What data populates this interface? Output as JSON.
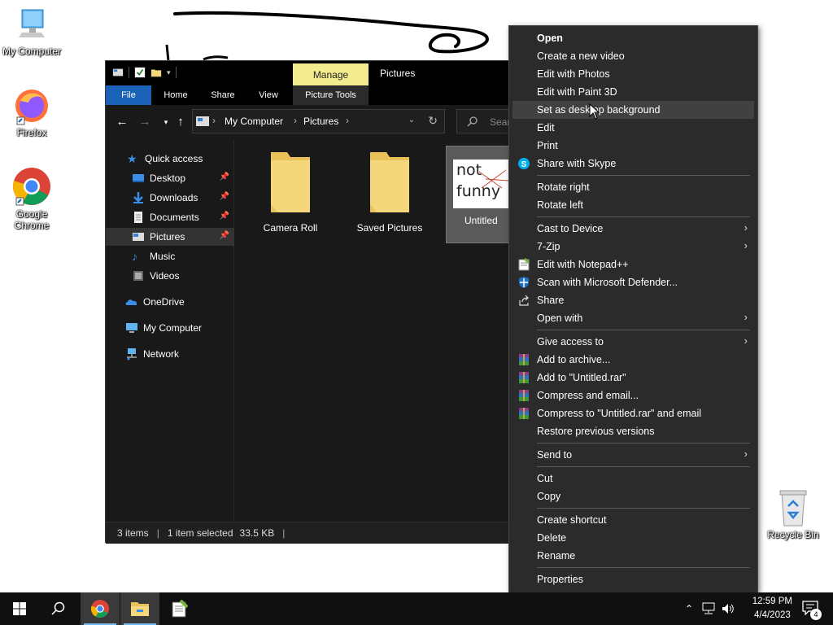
{
  "desktop": {
    "icons": [
      {
        "label": "My Computer"
      },
      {
        "label": "Firefox"
      },
      {
        "label": "Google Chrome"
      },
      {
        "label": "Recycle Bin"
      }
    ]
  },
  "explorer": {
    "quick_access_toolbar": [
      "properties-icon",
      "checkmark-icon",
      "new-folder-icon",
      "dropdown-icon"
    ],
    "contextual_tab_label": "Manage",
    "window_title": "Pictures",
    "ribbon_tabs": [
      "File",
      "Home",
      "Share",
      "View",
      "Picture Tools"
    ],
    "address": {
      "crumbs": [
        "My Computer",
        "Pictures"
      ]
    },
    "search_placeholder": "Sear",
    "nav_pane": [
      {
        "label": "Quick access",
        "icon": "star-icon",
        "pinned": false
      },
      {
        "label": "Desktop",
        "icon": "desktop-folder-icon",
        "pinned": true
      },
      {
        "label": "Downloads",
        "icon": "downloads-icon",
        "pinned": true
      },
      {
        "label": "Documents",
        "icon": "documents-icon",
        "pinned": true
      },
      {
        "label": "Pictures",
        "icon": "pictures-icon",
        "pinned": true,
        "selected": true
      },
      {
        "label": "Music",
        "icon": "music-icon",
        "pinned": false
      },
      {
        "label": "Videos",
        "icon": "videos-icon",
        "pinned": false
      },
      {
        "label": "OneDrive",
        "icon": "onedrive-icon",
        "pinned": false
      },
      {
        "label": "My Computer",
        "icon": "computer-icon",
        "pinned": false
      },
      {
        "label": "Network",
        "icon": "network-icon",
        "pinned": false
      }
    ],
    "items": [
      {
        "label": "Camera Roll",
        "type": "folder"
      },
      {
        "label": "Saved Pictures",
        "type": "folder"
      },
      {
        "label": "Untitled",
        "type": "image",
        "thumbnail_text_1": "not",
        "thumbnail_text_2": "funny",
        "selected": true
      }
    ],
    "status": {
      "count": "3 items",
      "selection": "1 item selected",
      "size": "33.5 KB"
    }
  },
  "context_menu": {
    "items": [
      {
        "label": "Open",
        "bold": true
      },
      {
        "label": "Create a new video"
      },
      {
        "label": "Edit with Photos"
      },
      {
        "label": "Edit with Paint 3D"
      },
      {
        "label": "Set as desktop background",
        "highlighted": true
      },
      {
        "label": "Edit"
      },
      {
        "label": "Print"
      },
      {
        "label": "Share with Skype",
        "icon": "skype-icon"
      },
      {
        "label": "Rotate right"
      },
      {
        "label": "Rotate left"
      },
      {
        "label": "Cast to Device",
        "submenu": true
      },
      {
        "label": "7-Zip",
        "submenu": true
      },
      {
        "label": "Edit with Notepad++",
        "icon": "notepadpp-icon"
      },
      {
        "label": "Scan with Microsoft Defender...",
        "icon": "defender-icon"
      },
      {
        "label": "Share",
        "icon": "share-icon"
      },
      {
        "label": "Open with",
        "submenu": true
      },
      {
        "label": "Give access to",
        "submenu": true
      },
      {
        "label": "Add to archive...",
        "icon": "winrar-icon"
      },
      {
        "label": "Add to \"Untitled.rar\"",
        "icon": "winrar-icon"
      },
      {
        "label": "Compress and email...",
        "icon": "winrar-icon"
      },
      {
        "label": "Compress to \"Untitled.rar\" and email",
        "icon": "winrar-icon"
      },
      {
        "label": "Restore previous versions"
      },
      {
        "label": "Send to",
        "submenu": true
      },
      {
        "label": "Cut"
      },
      {
        "label": "Copy"
      },
      {
        "label": "Create shortcut"
      },
      {
        "label": "Delete"
      },
      {
        "label": "Rename"
      },
      {
        "label": "Properties"
      }
    ]
  },
  "taskbar": {
    "apps": [
      "start-icon",
      "search-icon",
      "chrome-icon",
      "file-explorer-icon",
      "notepadpp-icon"
    ],
    "time": "12:59 PM",
    "date": "4/4/2023",
    "notification_count": "4"
  },
  "colors": {
    "file_tab": "#1a62b8",
    "manage_tab": "#f2ec8e",
    "menu_bg": "#2b2b2b",
    "folder": "#f4d77a"
  }
}
